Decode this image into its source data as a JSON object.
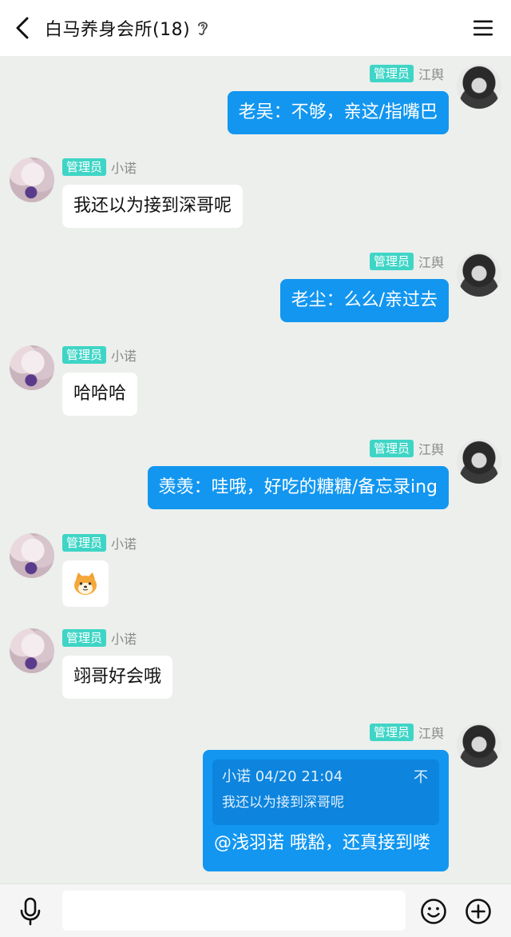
{
  "header": {
    "title": "白马养身会所(18)",
    "back_icon": "chevron-left-icon",
    "ear_icon": "ear-icon",
    "menu_icon": "hamburger-menu-icon"
  },
  "messages": [
    {
      "side": "right",
      "badge": "管理员",
      "name": "江舆",
      "text": "老吴：不够，亲这/指嘴巴"
    },
    {
      "side": "left",
      "badge": "管理员",
      "name": "小诺",
      "text": "我还以为接到深哥呢"
    },
    {
      "side": "right",
      "badge": "管理员",
      "name": "江舆",
      "text": "老尘：么么/亲过去"
    },
    {
      "side": "left",
      "badge": "管理员",
      "name": "小诺",
      "text": "哈哈哈"
    },
    {
      "side": "right",
      "badge": "管理员",
      "name": "江舆",
      "text": "羡羡：哇哦，好吃的糖糖/备忘录ing"
    },
    {
      "side": "left",
      "badge": "管理员",
      "name": "小诺",
      "sticker": "shiba-dog-emoji"
    },
    {
      "side": "left",
      "badge": "管理员",
      "name": "小诺",
      "text": "翊哥好会哦"
    },
    {
      "side": "right",
      "badge": "管理员",
      "name": "江舆",
      "quote": {
        "header": "小诺 04/20 21:04",
        "text": "我还以为接到深哥呢",
        "more": "不"
      },
      "text": "@浅羽诺 哦豁，还真接到喽"
    }
  ],
  "input": {
    "value": "",
    "placeholder": ""
  },
  "bottom_icons": [
    "microphone-icon",
    "smiley-icon",
    "plus-circle-icon"
  ],
  "colors": {
    "accent": "#1296f0",
    "badge": "#3fd5c6",
    "background": "#ecefec"
  }
}
